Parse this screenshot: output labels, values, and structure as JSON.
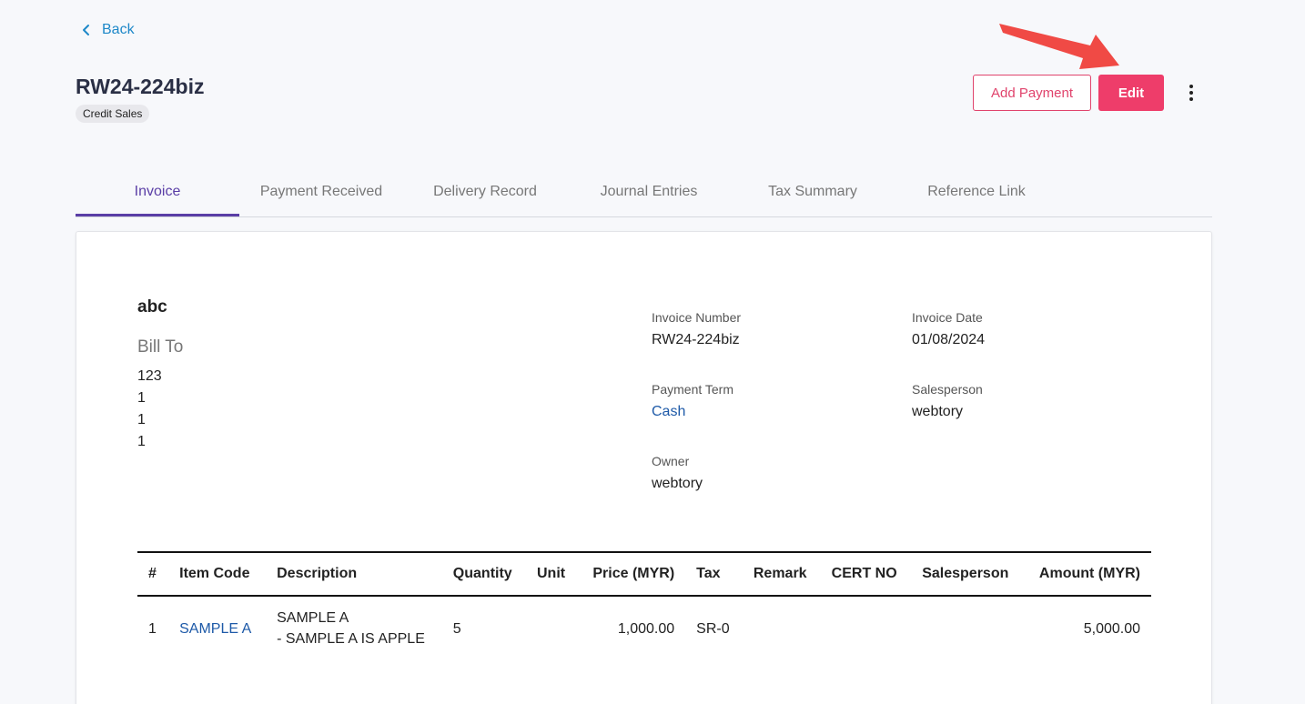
{
  "nav": {
    "back_label": "Back"
  },
  "header": {
    "title": "RW24-224biz",
    "badge": "Credit Sales",
    "add_payment_label": "Add Payment",
    "edit_label": "Edit"
  },
  "tabs": [
    "Invoice",
    "Payment Received",
    "Delivery Record",
    "Journal Entries",
    "Tax Summary",
    "Reference Link"
  ],
  "invoice": {
    "company": "abc",
    "bill_to_label": "Bill To",
    "address_lines": [
      "123",
      "1",
      "1",
      "1"
    ],
    "fields": {
      "invoice_number": {
        "label": "Invoice Number",
        "value": "RW24-224biz"
      },
      "invoice_date": {
        "label": "Invoice Date",
        "value": "01/08/2024"
      },
      "payment_term": {
        "label": "Payment Term",
        "value": "Cash"
      },
      "salesperson": {
        "label": "Salesperson",
        "value": "webtory"
      },
      "owner": {
        "label": "Owner",
        "value": "webtory"
      }
    },
    "table": {
      "headers": [
        "#",
        "Item Code",
        "Description",
        "Quantity",
        "Unit",
        "Price (MYR)",
        "Tax",
        "Remark",
        "CERT NO",
        "Salesperson",
        "Amount (MYR)"
      ],
      "rows": [
        {
          "index": "1",
          "item_code": "SAMPLE A",
          "description_line1": "SAMPLE A",
          "description_line2": "- SAMPLE A IS APPLE",
          "quantity": "5",
          "unit": "",
          "price": "1,000.00",
          "tax": "SR-0",
          "remark": "",
          "cert_no": "",
          "salesperson": "",
          "amount": "5,000.00"
        }
      ]
    }
  },
  "colors": {
    "accent": "#ee3d6a",
    "tab_active": "#5a3ea6",
    "link": "#1e5aa8",
    "annotation_arrow": "#f04a45"
  },
  "icons": {
    "back": "chevron-left-icon",
    "more": "kebab-icon",
    "annotation": "red-arrow-icon"
  }
}
